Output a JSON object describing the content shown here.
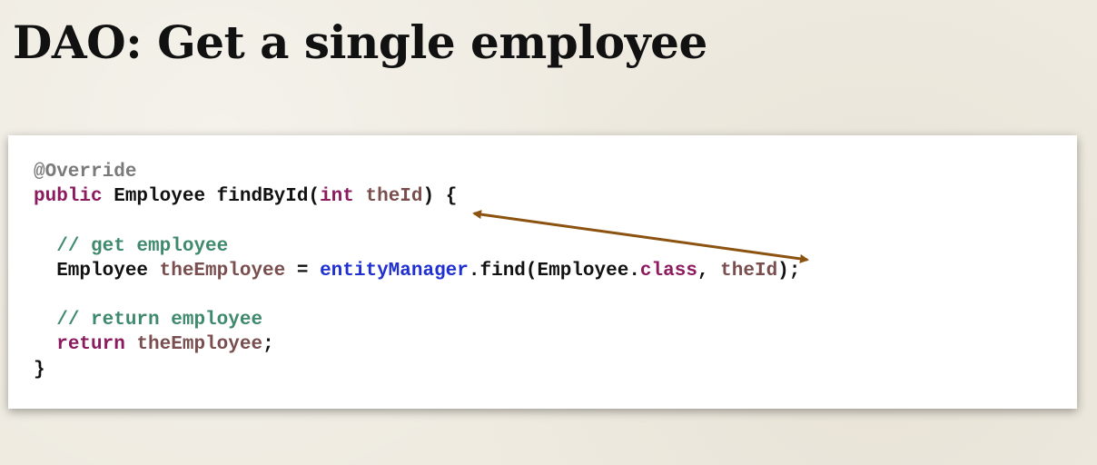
{
  "title": "DAO: Get a single employee",
  "colors": {
    "background": "#efebe1",
    "code_background": "#ffffff",
    "annotation": "#7a7a7a",
    "keyword": "#8b1a5e",
    "variable": "#7a4e4e",
    "comment": "#3f8a6e",
    "field": "#1f2fd1",
    "plain": "#111111",
    "arrow": "#8b5210"
  },
  "code": {
    "lines": [
      [
        {
          "t": "@Override",
          "c": "annotation"
        }
      ],
      [
        {
          "t": "public",
          "c": "keyword"
        },
        {
          "t": " Employee findById(",
          "c": "plain"
        },
        {
          "t": "int",
          "c": "keyword"
        },
        {
          "t": " ",
          "c": "plain"
        },
        {
          "t": "theId",
          "c": "variable"
        },
        {
          "t": ") {",
          "c": "plain"
        }
      ],
      [],
      [
        {
          "t": "  ",
          "c": "plain"
        },
        {
          "t": "// get employee",
          "c": "comment"
        }
      ],
      [
        {
          "t": "  Employee ",
          "c": "plain"
        },
        {
          "t": "theEmployee",
          "c": "variable"
        },
        {
          "t": " = ",
          "c": "plain"
        },
        {
          "t": "entityManager",
          "c": "field"
        },
        {
          "t": ".find(Employee.",
          "c": "plain"
        },
        {
          "t": "class",
          "c": "keyword"
        },
        {
          "t": ", ",
          "c": "plain"
        },
        {
          "t": "theId",
          "c": "variable"
        },
        {
          "t": ");",
          "c": "plain"
        }
      ],
      [],
      [
        {
          "t": "  ",
          "c": "plain"
        },
        {
          "t": "// return employee",
          "c": "comment"
        }
      ],
      [
        {
          "t": "  ",
          "c": "plain"
        },
        {
          "t": "return",
          "c": "keyword"
        },
        {
          "t": " ",
          "c": "plain"
        },
        {
          "t": "theEmployee",
          "c": "variable"
        },
        {
          "t": ";",
          "c": "plain"
        }
      ],
      [
        {
          "t": "}",
          "c": "plain"
        }
      ]
    ]
  },
  "arrow": {
    "description_from": "theId",
    "description_to": "theId"
  }
}
